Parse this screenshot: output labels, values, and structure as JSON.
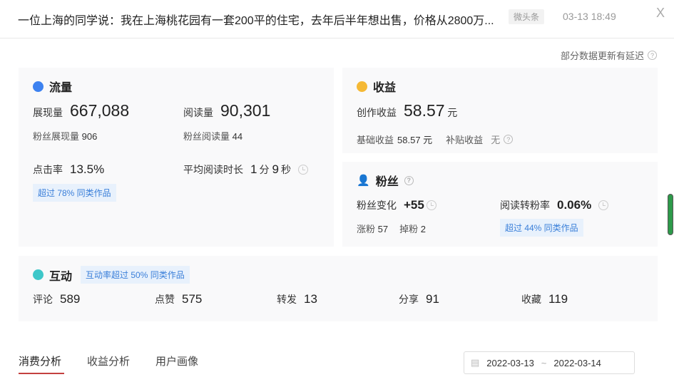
{
  "header": {
    "title": "一位上海的同学说：我在上海桃花园有一套200平的住宅，去年后半年想出售，价格从2800万...",
    "source": "微头条",
    "time": "03-13 18:49",
    "close": "X"
  },
  "notice": "部分数据更新有延迟",
  "traffic": {
    "title": "流量",
    "impressions_label": "展现量",
    "impressions": "667,088",
    "reads_label": "阅读量",
    "reads": "90,301",
    "fan_impressions_label": "粉丝展现量",
    "fan_impressions": "906",
    "fan_reads_label": "粉丝阅读量",
    "fan_reads": "44",
    "ctr_label": "点击率",
    "ctr": "13.5%",
    "ctr_badge": "超过 78% 同类作品",
    "avg_label": "平均阅读时长",
    "avg_min": "1",
    "min_unit": "分",
    "avg_sec": "9",
    "sec_unit": "秒"
  },
  "income": {
    "title": "收益",
    "label": "创作收益",
    "value": "58.57",
    "unit": "元",
    "base_label": "基础收益",
    "base_value": "58.57 元",
    "subsidy_label": "补贴收益",
    "subsidy_value": "无"
  },
  "fans": {
    "title": "粉丝",
    "change_label": "粉丝变化",
    "change": "+55",
    "gain_label": "涨粉",
    "gain": "57",
    "loss_label": "掉粉",
    "loss": "2",
    "rate_label": "阅读转粉率",
    "rate": "0.06%",
    "rate_badge": "超过 44% 同类作品"
  },
  "interact": {
    "title": "互动",
    "badge": "互动率超过 50% 同类作品",
    "items": [
      {
        "label": "评论",
        "value": "589"
      },
      {
        "label": "点赞",
        "value": "575"
      },
      {
        "label": "转发",
        "value": "13"
      },
      {
        "label": "分享",
        "value": "91"
      },
      {
        "label": "收藏",
        "value": "119"
      }
    ]
  },
  "tabs": [
    "消费分析",
    "收益分析",
    "用户画像"
  ],
  "date_range": {
    "start": "2022-03-13",
    "sep": "~",
    "end": "2022-03-14"
  },
  "colors": {
    "traffic": "#3d82f0",
    "income": "#f5b935",
    "fans": "#f06464",
    "interact": "#3ec7c9",
    "tab_active": "#c4403f"
  }
}
